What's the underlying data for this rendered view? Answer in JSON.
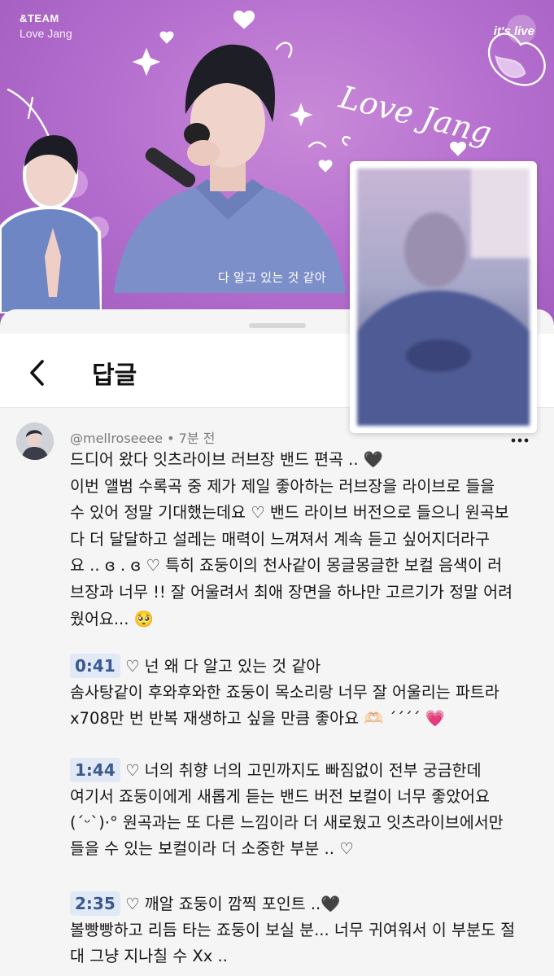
{
  "video": {
    "brand": "&TEAM",
    "subtitle": "Love Jang",
    "logo": "it's live",
    "lyric": "다 알고 있는 것 같아",
    "doodle_text": "Love Jang"
  },
  "header": {
    "title": "답글",
    "back_icon": "chevron-left-icon"
  },
  "comment": {
    "author": "@mellroseeee",
    "separator": "•",
    "time": "7분 전",
    "more_icon": "more-dots-icon",
    "intro_lines": [
      "드디어 왔다 잇츠라이브 러브장 밴드 편곡 .. 🖤",
      "이번 앨범 수록곡 중 제가 제일 좋아하는 러브장을 라이브로 들을",
      "수 있어 정말 기대했는데요 ♡ 밴드 라이브 버전으로 들으니 원곡보",
      "다 더 달달하고 설레는 매력이 느껴져서 계속 듣고 싶어지더라구",
      "요 .. ︎ɞ . ︎ɞ ♡ 특히 죠둥이의 천사같이 몽글몽글한 보컬 음색이 러",
      "브장과 너무 !! 잘 어울려서 최애 장면을 하나만 고르기가 정말 어려",
      "웠어요... 🥺"
    ],
    "sections": [
      {
        "timestamp": "0:41",
        "first": "♡ 넌 왜 다 알고 있는 것 같아",
        "lines": [
          "솜사탕같이 후와후와한 죠둥이 목소리랑 너무 잘 어울리는 파트라",
          "x708만 번 반복 재생하고 싶을 만큼 좋아요 🫶🏻 ˊˊˊˊ 💗"
        ]
      },
      {
        "timestamp": "1:44",
        "first": "♡ 너의 취향 너의 고민까지도 빠짐없이 전부 궁금한데",
        "lines": [
          "여기서 죠둥이에게 새롭게 듣는 밴드 버전 보컬이 너무 좋았어요",
          "(ˊᵕˋ)·° 원곡과는 또 다른 느낌이라 더 새로웠고 잇츠라이브에서만",
          "들을 수 있는 보컬이라 더 소중한 부분 .. ♡"
        ]
      },
      {
        "timestamp": "2:35",
        "first": "♡ 깨알 죠둥이 깜찍 포인트 ..🖤",
        "lines": [
          "볼빵빵하고 리듬 타는 죠둥이 보실 분... 너무 귀여워서 이 부분도 절",
          "대 그냥 지나칠 수 Xx .."
        ]
      }
    ]
  },
  "colors": {
    "video_bg": "#b56fcf",
    "timestamp_bg": "#e1e9f6",
    "timestamp_text": "#3a5a8c"
  }
}
